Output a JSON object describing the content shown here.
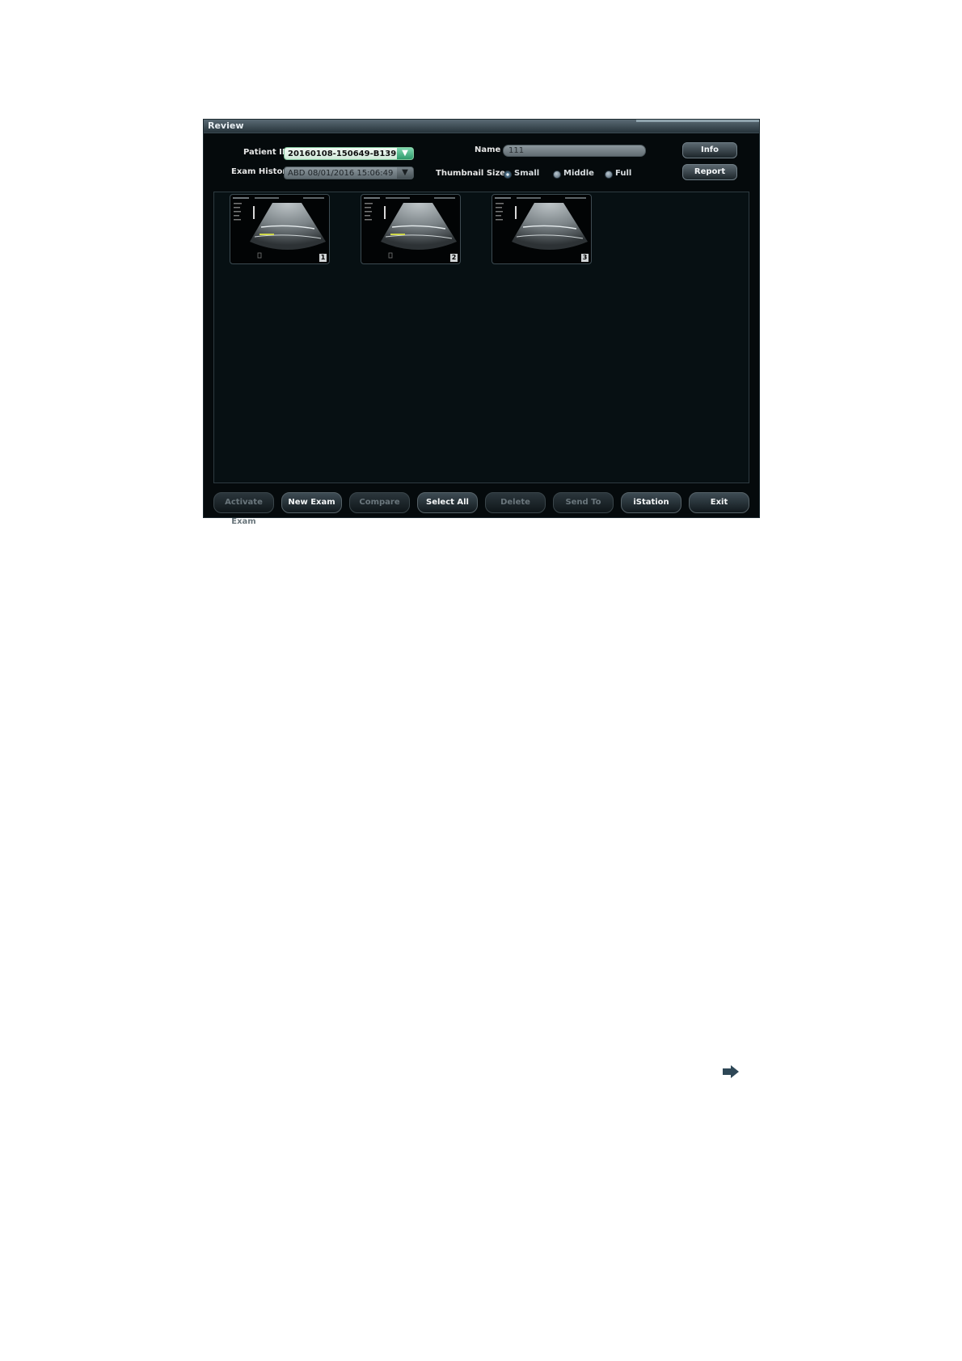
{
  "window": {
    "title": "Review"
  },
  "form": {
    "patient_id_label": "Patient ID",
    "patient_id_value": "20160108-150649-B139",
    "exam_history_label": "Exam History",
    "exam_history_value": "ABD 08/01/2016 15:06:49",
    "name_label": "Name",
    "name_value": "111",
    "thumbnail_size_label": "Thumbnail Size",
    "thumbnail_options": [
      "Small",
      "Middle",
      "Full"
    ],
    "thumbnail_selected": "Small"
  },
  "side_buttons": {
    "info": "Info",
    "report": "Report"
  },
  "thumbnails": [
    "1",
    "2",
    "3"
  ],
  "bottom_buttons": [
    {
      "label": "Activate Exam",
      "enabled": false
    },
    {
      "label": "New Exam",
      "enabled": true
    },
    {
      "label": "Compare",
      "enabled": false
    },
    {
      "label": "Select All",
      "enabled": true
    },
    {
      "label": "Delete",
      "enabled": false
    },
    {
      "label": "Send To",
      "enabled": false
    },
    {
      "label": "iStation",
      "enabled": true
    },
    {
      "label": "Exit",
      "enabled": true
    }
  ],
  "icons": {
    "combo_arrow": "triangle-down-icon",
    "page_arrow": "arrow-right-icon"
  },
  "colors": {
    "window_bg": "#050a0c",
    "active_combo_accent": "#2f9a6c",
    "page_arrow": "#2e4756"
  }
}
